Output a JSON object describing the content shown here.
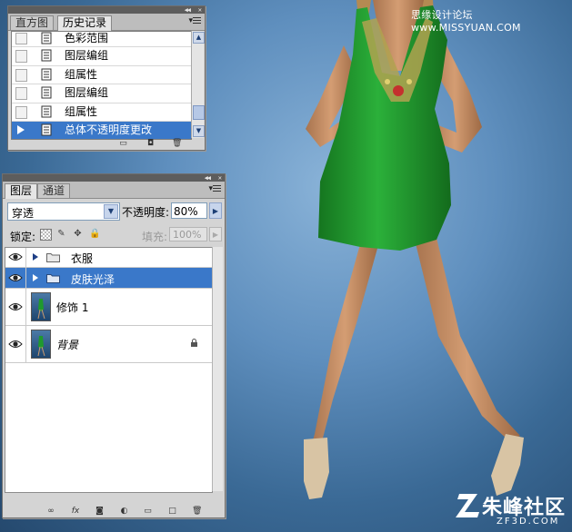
{
  "history_panel": {
    "tabs": [
      "直方图",
      "历史记录"
    ],
    "active_tab": 1,
    "items": [
      {
        "label": "色彩范围"
      },
      {
        "label": "图层编组"
      },
      {
        "label": "组属性"
      },
      {
        "label": "图层编组"
      },
      {
        "label": "组属性"
      },
      {
        "label": "总体不透明度更改",
        "selected": true
      }
    ]
  },
  "layers_panel": {
    "tabs": [
      "图层",
      "通道"
    ],
    "active_tab": 0,
    "blend_mode": "穿透",
    "opacity_label": "不透明度:",
    "opacity_value": "80%",
    "lock_label": "锁定:",
    "fill_label": "填充:",
    "fill_value": "100%",
    "layers": [
      {
        "name": "衣服",
        "type": "group",
        "selected": false
      },
      {
        "name": "皮肤光泽",
        "type": "group",
        "selected": true
      },
      {
        "name": "修饰 1",
        "type": "layer",
        "selected": false
      },
      {
        "name": "背景",
        "type": "background",
        "selected": false,
        "locked": true
      }
    ]
  },
  "watermark": {
    "top_text": "思缘设计论坛 www.MISSYUAN.COM",
    "brand": "朱峰社区",
    "domain": "ZF3D.COM"
  },
  "colors": {
    "selection": "#3a78c9",
    "panel_bg": "#d4d4d4",
    "dress": "#1f9a2e",
    "backdrop": "#4a7aa8"
  }
}
